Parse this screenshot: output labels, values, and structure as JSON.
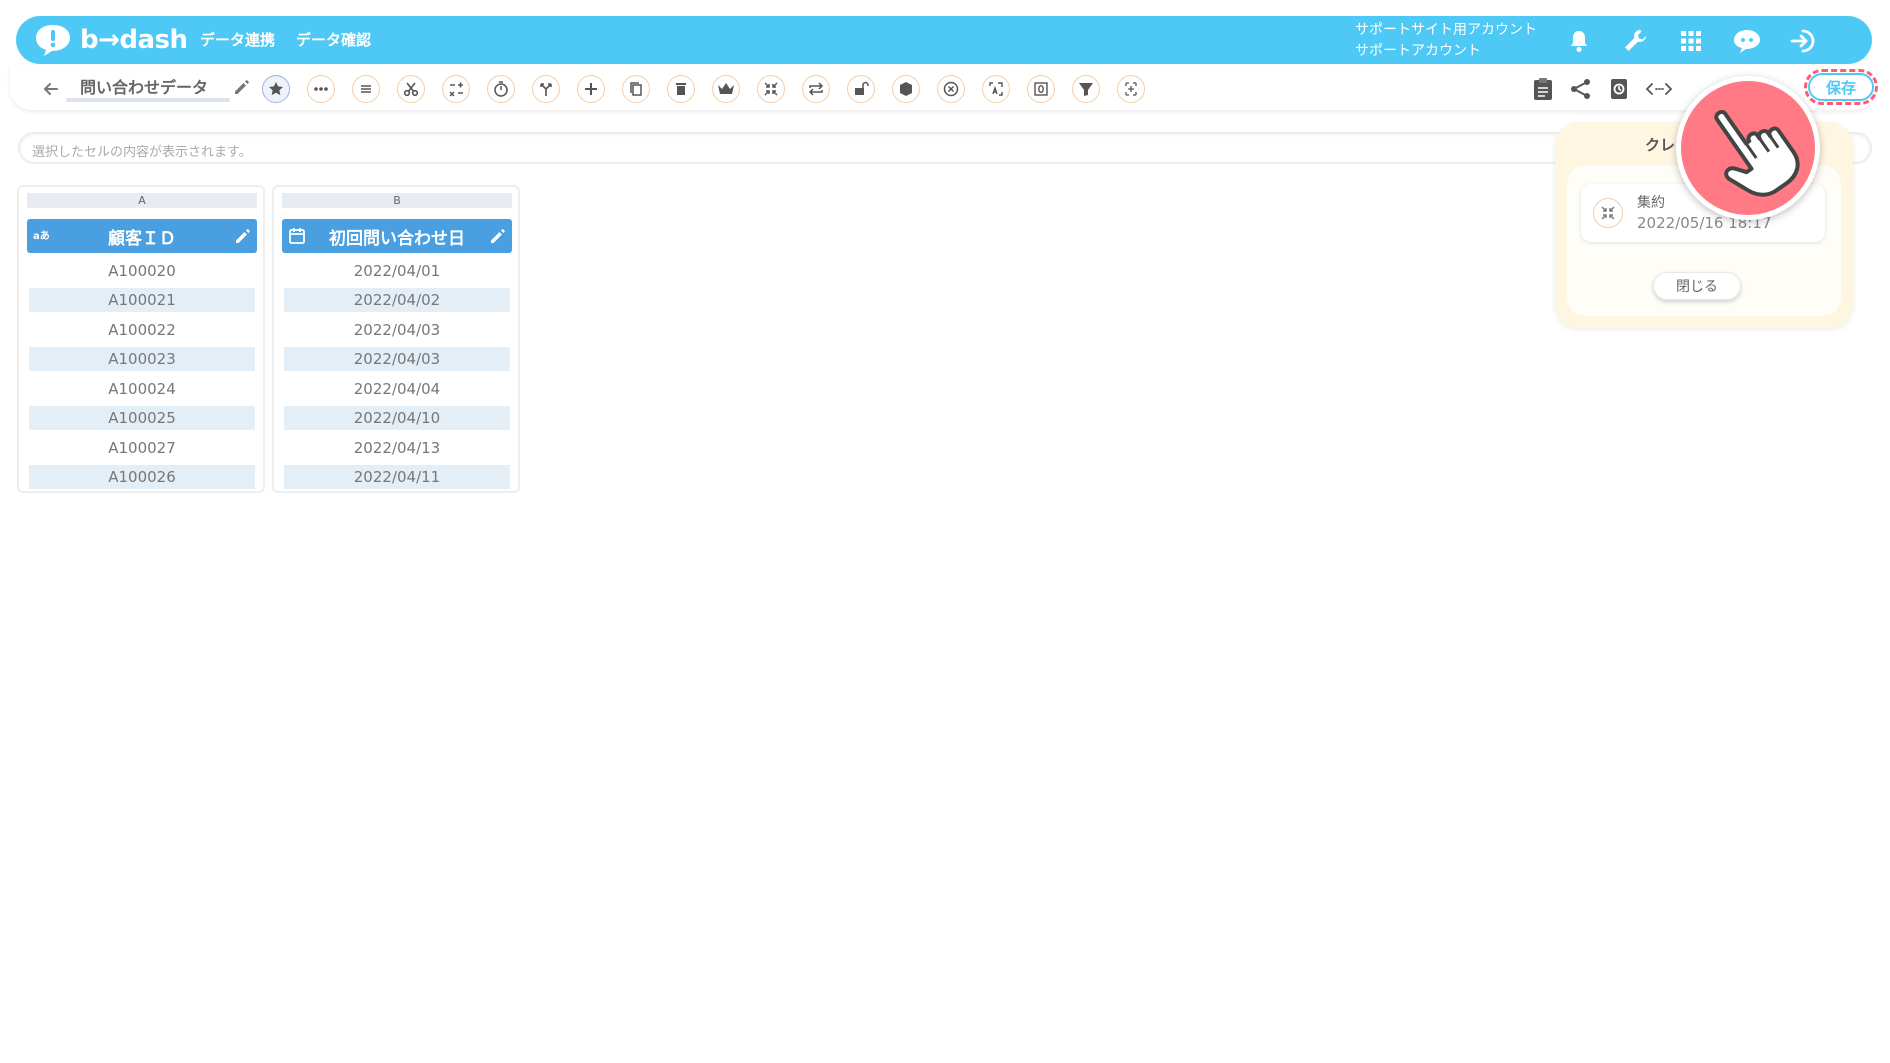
{
  "header": {
    "logo_text": "b→dash",
    "nav": [
      "データ連携",
      "データ確認"
    ],
    "account_line1": "サポートサイト用アカウント",
    "account_line2": "サポートアカウント",
    "icons": [
      "bell-icon",
      "wrench-icon",
      "apps-grid-icon",
      "support-chat-icon",
      "logout-icon"
    ]
  },
  "toolbar": {
    "title": "問い合わせデータ",
    "save_label": "保存",
    "tools": [
      "star-icon",
      "more-icon",
      "list-icon",
      "cut-icon",
      "calc-icon",
      "timer-icon",
      "branch-icon",
      "add-icon",
      "copy-icon",
      "delete-icon",
      "crown-icon",
      "aggregate-icon",
      "repeat-icon",
      "lock-icon",
      "package-icon",
      "close-circle-icon",
      "translate-icon",
      "zero-icon",
      "filter-icon",
      "pattern-icon"
    ],
    "right_icons": [
      "clipboard-icon",
      "share-icon",
      "history-icon",
      "code-icon"
    ]
  },
  "cellbar": {
    "placeholder": "選択したセルの内容が表示されます。"
  },
  "columns": [
    {
      "letter": "A",
      "type": "aあ",
      "name": "顧客ＩＤ",
      "cells": [
        "A100020",
        "A100021",
        "A100022",
        "A100023",
        "A100024",
        "A100025",
        "A100027",
        "A100026"
      ]
    },
    {
      "letter": "B",
      "type": "calendar-icon",
      "name": "初回問い合わせ日",
      "cells": [
        "2022/04/01",
        "2022/04/02",
        "2022/04/03",
        "2022/04/03",
        "2022/04/04",
        "2022/04/10",
        "2022/04/13",
        "2022/04/11"
      ]
    }
  ],
  "credit_panel": {
    "title": "クレ",
    "item_name": "集約",
    "item_date": "2022/05/16 18:17",
    "close_label": "閉じる"
  },
  "colors": {
    "brand": "#4ec9f5",
    "column_header": "#4a9fe0",
    "highlight": "#ff5a77",
    "pointer": "#ff7a84"
  }
}
